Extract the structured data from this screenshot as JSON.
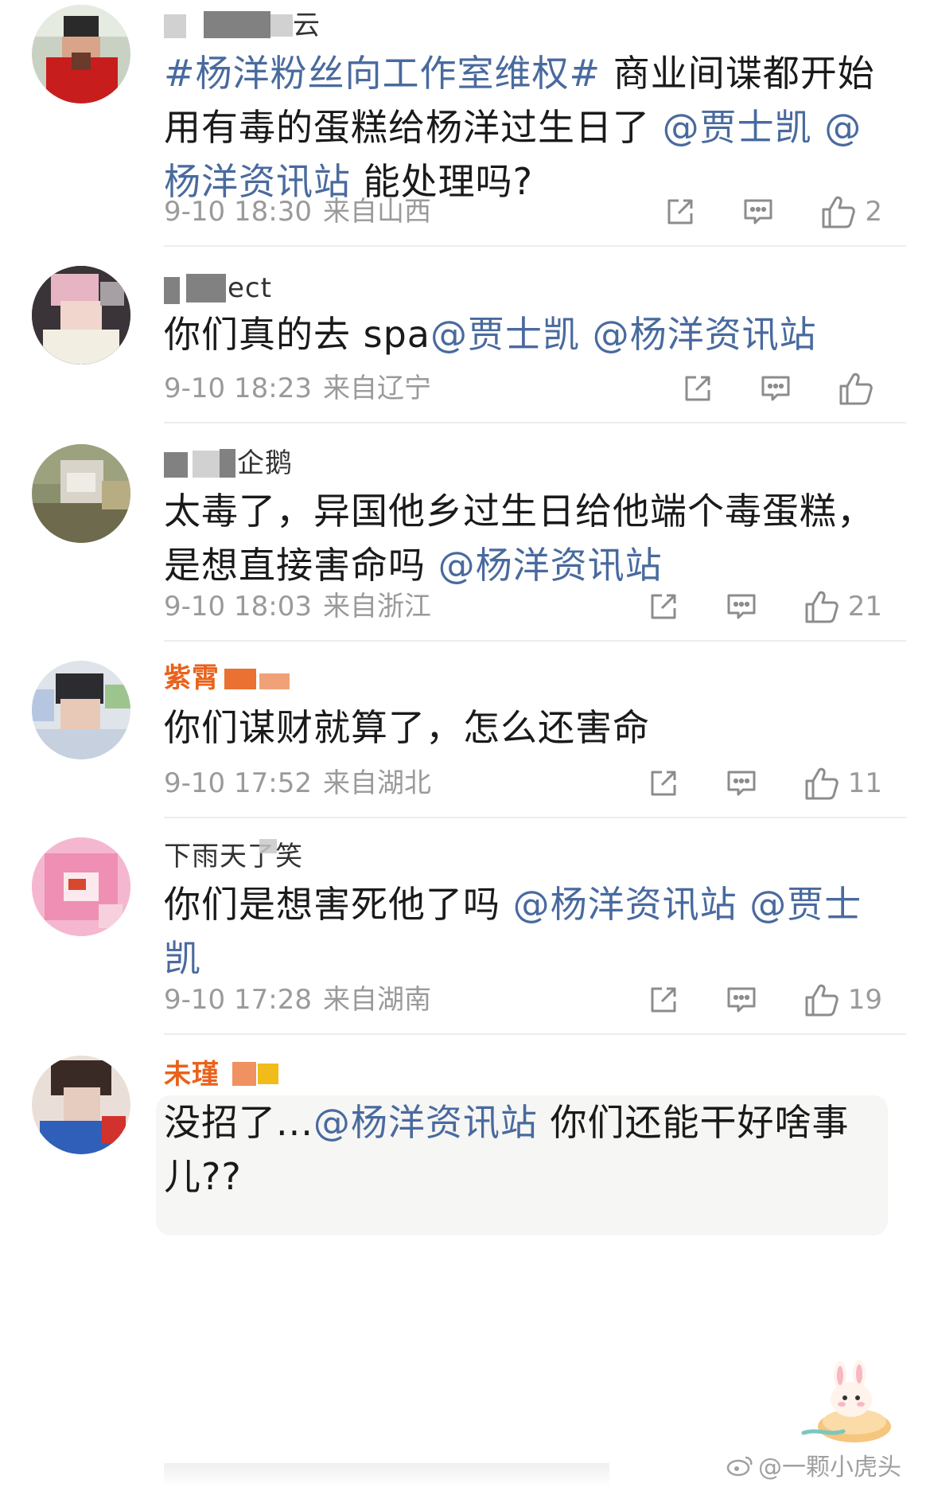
{
  "colors": {
    "link": "#496a9e",
    "meta": "#9a9a9a",
    "text": "#1a1a1a",
    "vip_name": "#e8621c"
  },
  "icons": [
    "repost-icon",
    "comment-icon",
    "like-icon"
  ],
  "comments": [
    {
      "username": "云",
      "body_parts": [
        {
          "text": "#杨洋粉丝向工作室维权#",
          "link": true
        },
        {
          "text": " 商业间谍都开始用有毒的蛋糕给杨洋过生日了 ",
          "link": false
        },
        {
          "text": "@贾士凯",
          "link": true
        },
        {
          "text": " ",
          "link": false
        },
        {
          "text": "@杨洋资讯站",
          "link": true
        },
        {
          "text": " 能处理吗?",
          "link": false
        }
      ],
      "time": "9-10 18:30",
      "location": "来自山西",
      "likes": "2"
    },
    {
      "username": "ect",
      "body_parts": [
        {
          "text": "你们真的去 spa",
          "link": false
        },
        {
          "text": "@贾士凯",
          "link": true
        },
        {
          "text": " ",
          "link": false
        },
        {
          "text": "@杨洋资讯站",
          "link": true
        }
      ],
      "time": "9-10 18:23",
      "location": "来自辽宁",
      "likes": ""
    },
    {
      "username": "企鹅",
      "body_parts": [
        {
          "text": "太毒了，异国他乡过生日给他端个毒蛋糕，是想直接害命吗 ",
          "link": false
        },
        {
          "text": "@杨洋资讯站",
          "link": true
        }
      ],
      "time": "9-10 18:03",
      "location": "来自浙江",
      "likes": "21"
    },
    {
      "username": "紫霄",
      "body_parts": [
        {
          "text": "你们谋财就算了，怎么还害命",
          "link": false
        }
      ],
      "time": "9-10 17:52",
      "location": "来自湖北",
      "likes": "11"
    },
    {
      "username": "下雨天了笑",
      "body_parts": [
        {
          "text": "你们是想害死他了吗 ",
          "link": false
        },
        {
          "text": "@杨洋资讯站",
          "link": true
        },
        {
          "text": " ",
          "link": false
        },
        {
          "text": "@贾士凯",
          "link": true
        }
      ],
      "time": "9-10 17:28",
      "location": "来自湖南",
      "likes": "19"
    },
    {
      "username": "未瑾",
      "body_parts": [
        {
          "text": "没招了...",
          "link": false
        },
        {
          "text": "@杨洋资讯站",
          "link": true
        },
        {
          "text": " 你们还能干好啥事儿??",
          "link": false
        }
      ],
      "time": "",
      "location": "",
      "likes": ""
    }
  ],
  "watermark": "@一颗小虎头"
}
